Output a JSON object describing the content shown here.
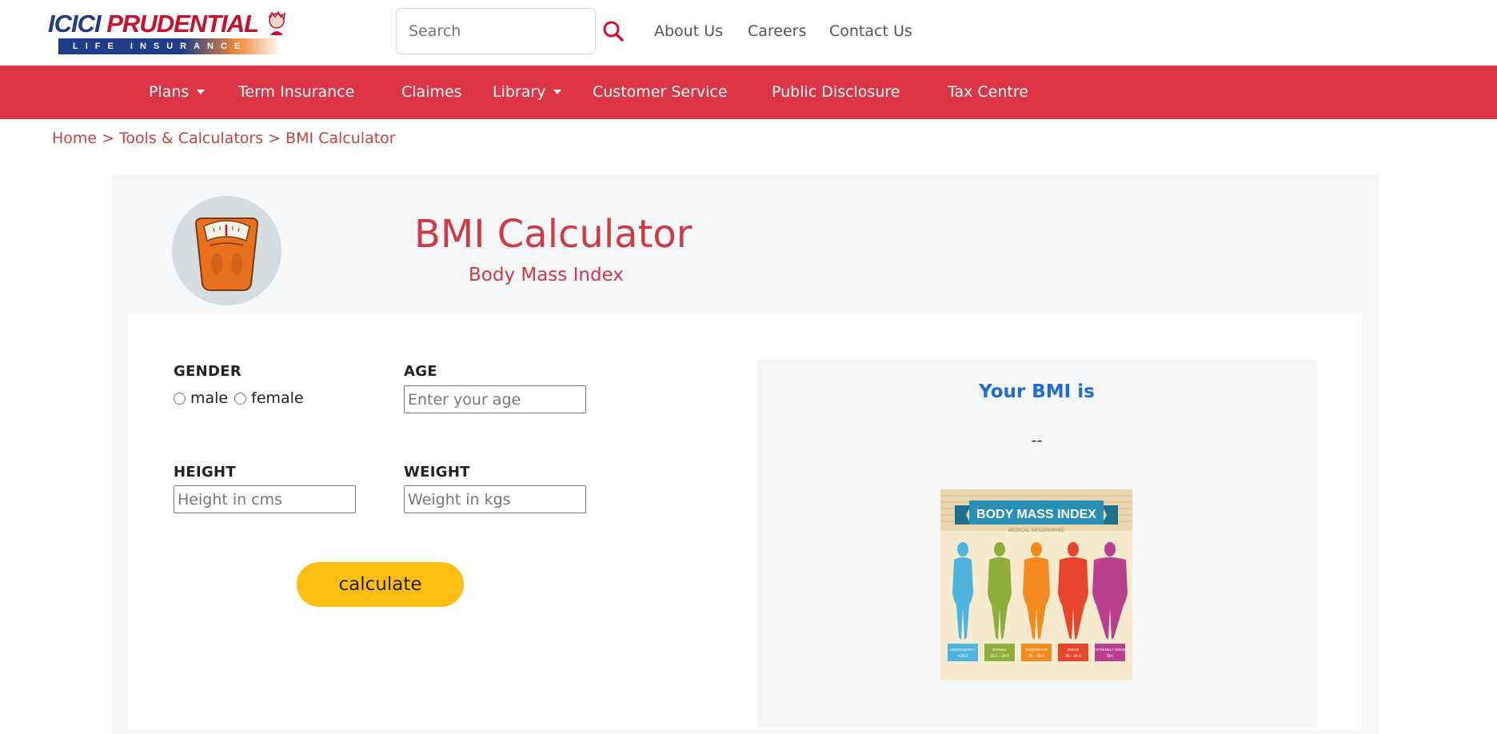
{
  "header": {
    "logo": {
      "brand_part1": "ICICI",
      "brand_part2": "PRUDENTIAL",
      "tagline": "LIFE INSURANCE"
    },
    "search": {
      "placeholder": "Search",
      "value": ""
    },
    "links": [
      "About Us",
      "Careers",
      "Contact Us"
    ]
  },
  "nav": {
    "items": [
      {
        "label": "Plans",
        "dropdown": true
      },
      {
        "label": "Term Insurance",
        "dropdown": false
      },
      {
        "label": "Claimes",
        "dropdown": false
      },
      {
        "label": "Library",
        "dropdown": true
      },
      {
        "label": "Customer Service",
        "dropdown": false
      },
      {
        "label": "Public Disclosure",
        "dropdown": false
      },
      {
        "label": "Tax Centre",
        "dropdown": false
      }
    ]
  },
  "breadcrumb": {
    "items": [
      "Home",
      "Tools & Calculators",
      "BMI Calculator"
    ],
    "separator": ">"
  },
  "calculator": {
    "title": "BMI Calculator",
    "subtitle": "Body Mass Index",
    "gender": {
      "label": "GENDER",
      "options": [
        "male",
        "female"
      ],
      "selected": null
    },
    "age": {
      "label": "AGE",
      "placeholder": "Enter your age",
      "value": ""
    },
    "height": {
      "label": "HEIGHT",
      "placeholder": "Height in cms",
      "value": ""
    },
    "weight": {
      "label": "WEIGHT",
      "placeholder": "Weight in kgs",
      "value": ""
    },
    "button": "calculate"
  },
  "result": {
    "title": "Your BMI is",
    "value": "--",
    "infographic": {
      "title": "BODY MASS INDEX",
      "subtitle": "MEDICAL INFOGRAPHIC",
      "categories": [
        {
          "name": "UNDERWEIGHT",
          "range": "<18.5",
          "color": "#4fb3df"
        },
        {
          "name": "NORMAL",
          "range": "18.5 - 24.9",
          "color": "#8fae3b"
        },
        {
          "name": "OVERWEIGHT",
          "range": "25 - 29.9",
          "color": "#f28a1f"
        },
        {
          "name": "OBESE",
          "range": "30 - 34.9",
          "color": "#e8452c"
        },
        {
          "name": "EXTREMELY OBESE",
          "range": "35<",
          "color": "#b8408e"
        }
      ]
    }
  },
  "colors": {
    "brand_red": "#dc3545",
    "title_red": "#d03a45",
    "button_yellow": "#fdbe12",
    "result_blue": "#1e6bd6"
  }
}
